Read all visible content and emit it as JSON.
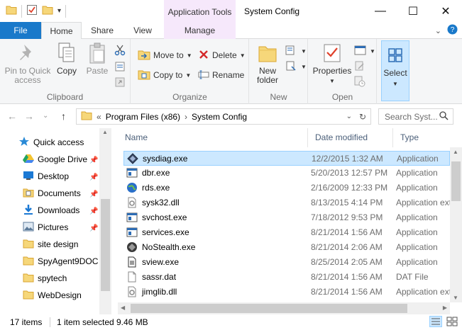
{
  "window": {
    "title": "System Config",
    "contextual_tab": "Application Tools",
    "minimize_glyph": "—",
    "maximize_glyph": "☐",
    "close_glyph": "✕"
  },
  "ribbon_tabs": {
    "file": "File",
    "home": "Home",
    "share": "Share",
    "view": "View",
    "manage": "Manage"
  },
  "ribbon": {
    "clipboard": {
      "label": "Clipboard",
      "pin": "Pin to Quick access",
      "copy": "Copy",
      "paste": "Paste"
    },
    "organize": {
      "label": "Organize",
      "move_to": "Move to",
      "copy_to": "Copy to",
      "delete": "Delete",
      "rename": "Rename"
    },
    "new": {
      "label": "New",
      "new_folder": "New folder"
    },
    "open": {
      "label": "Open",
      "properties": "Properties"
    },
    "select": {
      "label": "Select"
    }
  },
  "address": {
    "overflow": "«",
    "crumbs": [
      "Program Files (x86)",
      "System Config"
    ],
    "search_placeholder": "Search Syst..."
  },
  "nav": {
    "items": [
      {
        "label": "Quick access",
        "icon": "star-icon",
        "pinned": false
      },
      {
        "label": "Google Drive",
        "icon": "google-drive-icon",
        "pinned": true
      },
      {
        "label": "Desktop",
        "icon": "desktop-icon",
        "pinned": true
      },
      {
        "label": "Documents",
        "icon": "documents-icon",
        "pinned": true
      },
      {
        "label": "Downloads",
        "icon": "downloads-icon",
        "pinned": true
      },
      {
        "label": "Pictures",
        "icon": "pictures-icon",
        "pinned": true
      },
      {
        "label": "site design",
        "icon": "folder-icon",
        "pinned": false
      },
      {
        "label": "SpyAgent9DOC",
        "icon": "folder-icon",
        "pinned": false
      },
      {
        "label": "spytech",
        "icon": "folder-icon",
        "pinned": false
      },
      {
        "label": "WebDesign",
        "icon": "folder-icon",
        "pinned": false
      }
    ]
  },
  "columns": {
    "name": "Name",
    "date": "Date modified",
    "type": "Type"
  },
  "files": [
    {
      "name": "sysdiag.exe",
      "date": "12/2/2015 1:32 AM",
      "type": "Application",
      "icon": "diamond-exe-icon",
      "selected": true
    },
    {
      "name": "dbr.exe",
      "date": "5/20/2013 12:57 PM",
      "type": "Application",
      "icon": "window-exe-icon",
      "selected": false
    },
    {
      "name": "rds.exe",
      "date": "2/16/2009 12:33 PM",
      "type": "Application",
      "icon": "globe-exe-icon",
      "selected": false
    },
    {
      "name": "sysk32.dll",
      "date": "8/13/2015 4:14 PM",
      "type": "Application extension",
      "icon": "dll-icon",
      "selected": false
    },
    {
      "name": "svchost.exe",
      "date": "7/18/2012 9:53 PM",
      "type": "Application",
      "icon": "window-exe-icon",
      "selected": false
    },
    {
      "name": "services.exe",
      "date": "8/21/2014 1:56 AM",
      "type": "Application",
      "icon": "window-exe-icon",
      "selected": false
    },
    {
      "name": "NoStealth.exe",
      "date": "8/21/2014 2:06 AM",
      "type": "Application",
      "icon": "stealth-exe-icon",
      "selected": false
    },
    {
      "name": "sview.exe",
      "date": "8/25/2014 2:05 AM",
      "type": "Application",
      "icon": "document-exe-icon",
      "selected": false
    },
    {
      "name": "sassr.dat",
      "date": "8/21/2014 1:56 AM",
      "type": "DAT File",
      "icon": "blank-file-icon",
      "selected": false
    },
    {
      "name": "jimglib.dll",
      "date": "8/21/2014 1:56 AM",
      "type": "Application extension",
      "icon": "dll-icon",
      "selected": false
    }
  ],
  "status": {
    "count": "17 items",
    "selection": "1 item selected",
    "size": "9.46 MB"
  },
  "colors": {
    "accent": "#1979ca",
    "selection_bg": "#cce8ff",
    "selection_border": "#99d1ff",
    "context_tab": "#f6e8fb"
  }
}
